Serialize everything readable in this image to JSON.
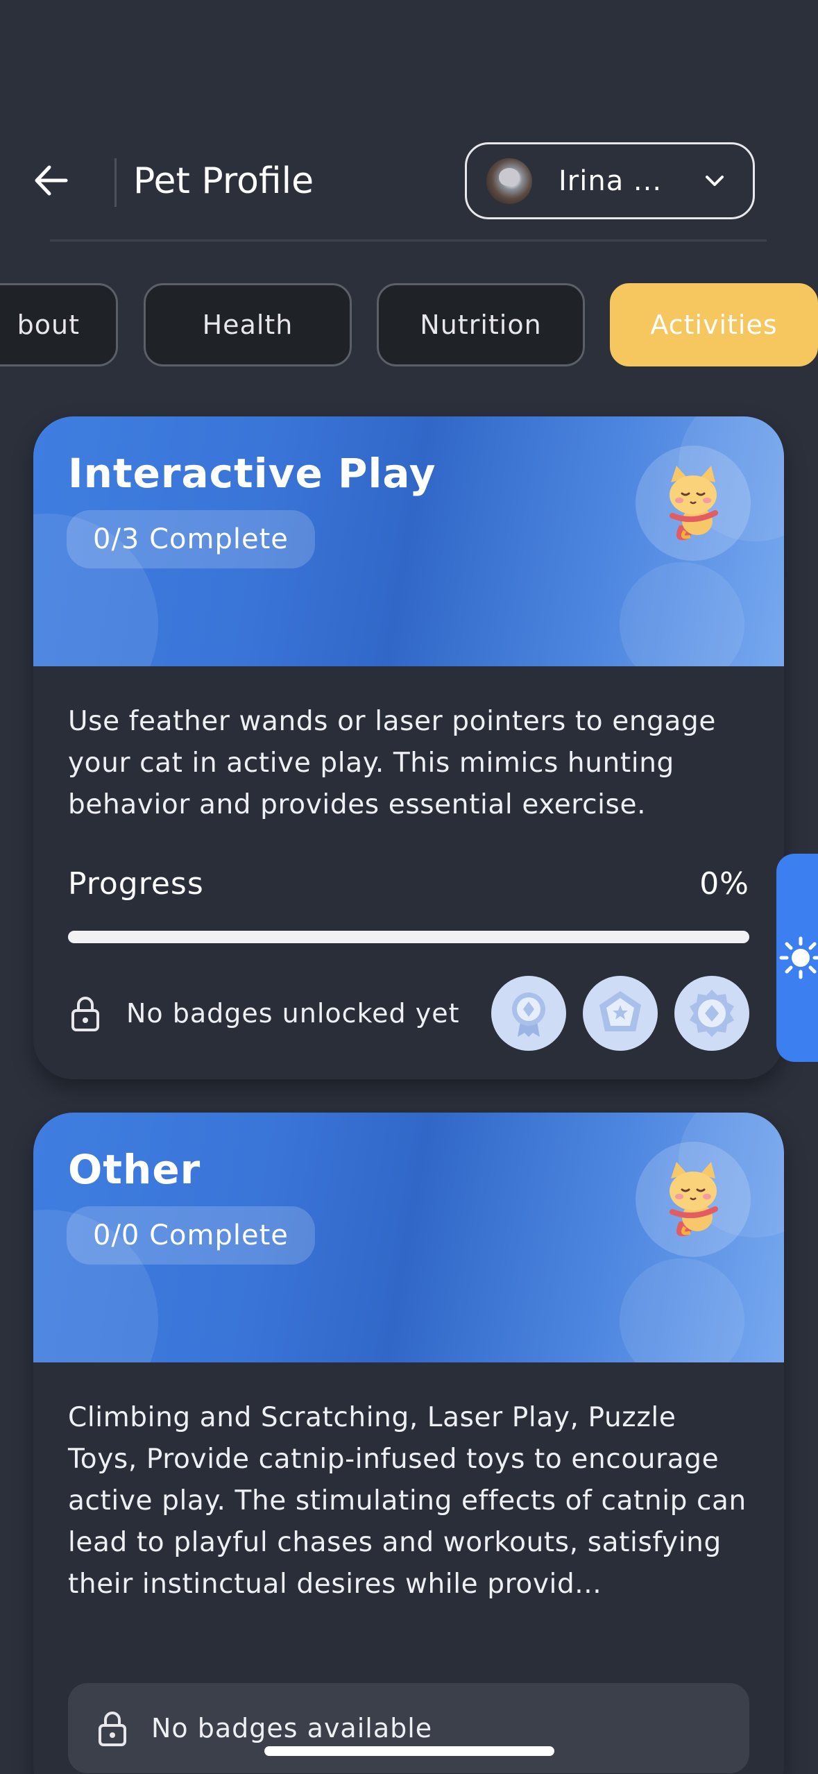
{
  "header": {
    "title": "Pet Profile",
    "pet_selector": {
      "name": "Irina ...",
      "avatar": "cat-photo"
    }
  },
  "tabs": [
    {
      "label": "About",
      "visible_text": "bout",
      "active": false
    },
    {
      "label": "Health",
      "active": false
    },
    {
      "label": "Nutrition",
      "active": false
    },
    {
      "label": "Activities",
      "active": true
    }
  ],
  "activities": [
    {
      "title": "Interactive Play",
      "complete": "0/3 Complete",
      "description": "Use feather wands or laser pointers to engage your cat in active play. This mimics hunting behavior and provides essential exercise.",
      "progress_label": "Progress",
      "progress_value": "0%",
      "progress_fraction": 0,
      "badge_status": "No badges unlocked yet",
      "badges": [
        "ribbon-medal-icon",
        "star-shield-badge-icon",
        "gear-medal-icon"
      ]
    },
    {
      "title": "Other",
      "complete": "0/0 Complete",
      "description": "Climbing and Scratching, Laser Play, Puzzle Toys, Provide catnip-infused toys to encourage active play. The stimulating effects of catnip can lead to playful chases and workouts, satisfying their instinctual desires while provid...",
      "badge_status": "No badges available"
    }
  ],
  "colors": {
    "background": "#2b303b",
    "card": "#292e39",
    "accent": "#f7c75f",
    "banner_blue": "#3a75d8",
    "toggle_blue": "#3c7ff0"
  },
  "icons": {
    "back": "arrow-left-icon",
    "dropdown": "chevron-down-icon",
    "lock": "lock-icon",
    "theme": "sun-icon",
    "mascot": "cat-mascot-icon"
  }
}
